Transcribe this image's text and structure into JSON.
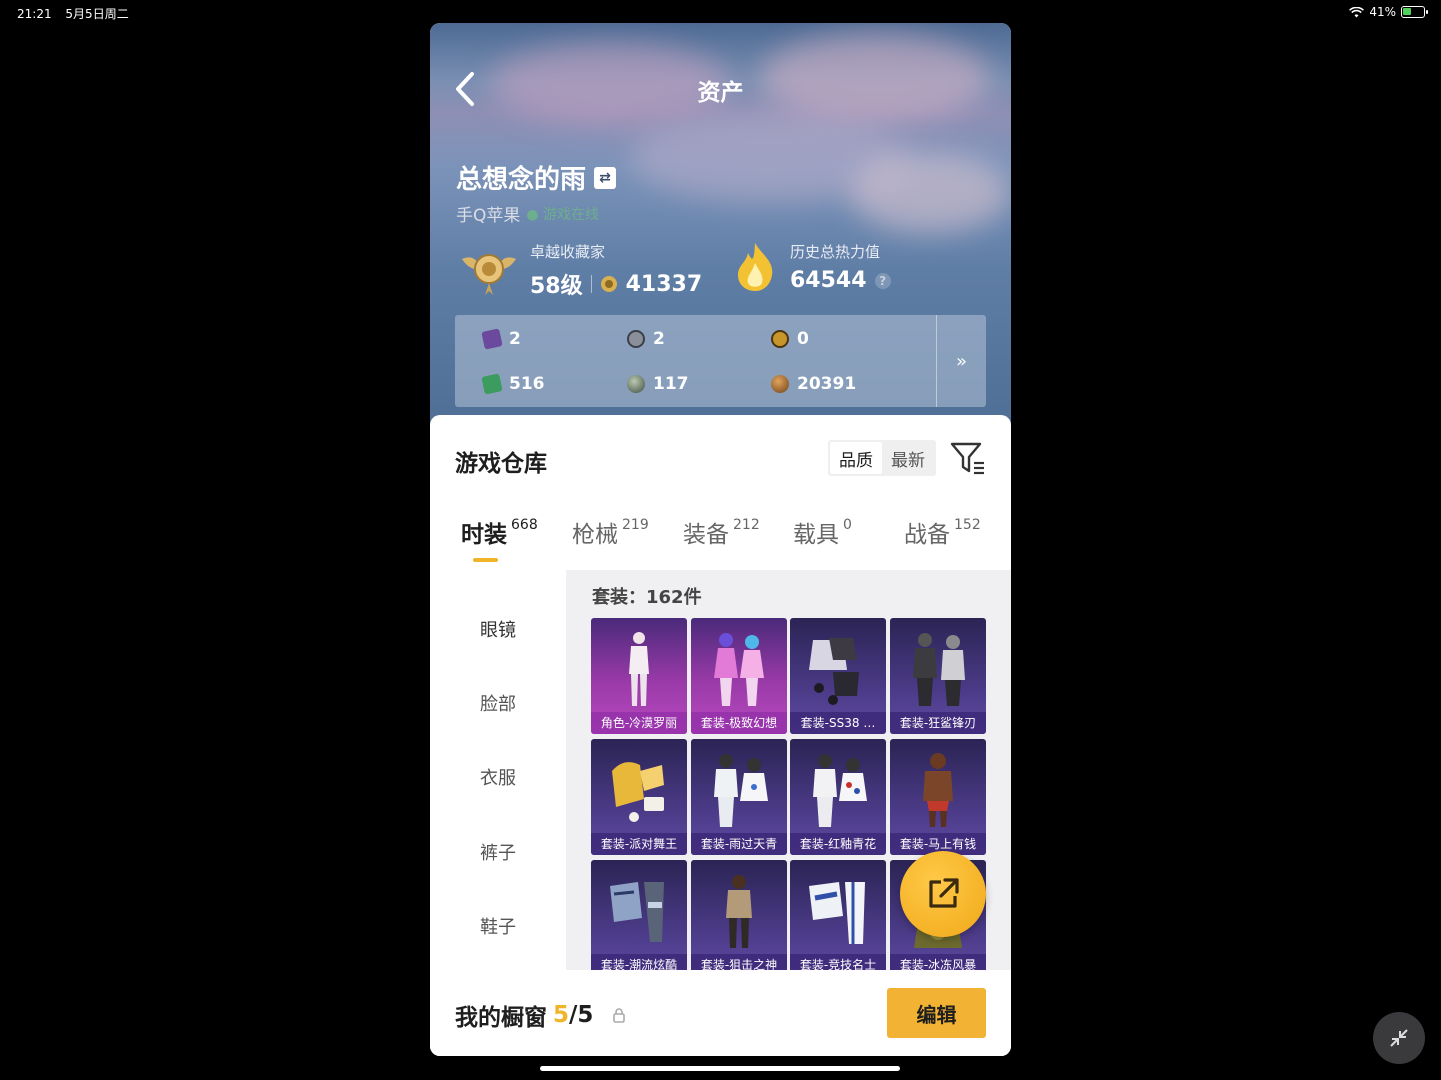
{
  "status_bar": {
    "time": "21:21",
    "date": "5月5日周二",
    "battery": "41%"
  },
  "header": {
    "title": "资产"
  },
  "profile": {
    "username": "总想念的雨",
    "platform": "手Q苹果",
    "online_status": "游戏在线"
  },
  "stats": {
    "collector_label": "卓越收藏家",
    "collector_level": "58级",
    "collector_points": "41337",
    "heat_label": "历史总热力值",
    "heat_value": "64544",
    "help_icon": "?"
  },
  "currencies": [
    {
      "icon": "purple-card-icon",
      "value": "2",
      "color": "#6b4a9e"
    },
    {
      "icon": "silver-coin-icon",
      "value": "2",
      "color": "#8a8f99"
    },
    {
      "icon": "gold-coin-icon",
      "value": "0",
      "color": "#c8952b"
    },
    {
      "icon": "green-card-icon",
      "value": "516",
      "color": "#3c9b5f"
    },
    {
      "icon": "gray-orb-icon",
      "value": "117",
      "color": "#6a7f6a"
    },
    {
      "icon": "bronze-coin-icon",
      "value": "20391",
      "color": "#b57a3c"
    }
  ],
  "warehouse": {
    "title": "游戏仓库",
    "sort_quality": "品质",
    "sort_newest": "最新",
    "tabs": [
      {
        "label": "时装",
        "count": "668"
      },
      {
        "label": "枪械",
        "count": "219"
      },
      {
        "label": "装备",
        "count": "212"
      },
      {
        "label": "载具",
        "count": "0"
      },
      {
        "label": "战备",
        "count": "152"
      }
    ],
    "subnav": [
      "眼镜",
      "脸部",
      "衣服",
      "裤子",
      "鞋子"
    ],
    "count_label": "套装：162件",
    "items": [
      {
        "name": "角色-冷漠罗丽",
        "style": "purple"
      },
      {
        "name": "套装-极致幻想",
        "style": "purple"
      },
      {
        "name": "套装-SS38 …",
        "style": "violet"
      },
      {
        "name": "套装-狂鲨锋刃",
        "style": "violet"
      },
      {
        "name": "套装-派对舞王",
        "style": "violet"
      },
      {
        "name": "套装-雨过天青",
        "style": "violet"
      },
      {
        "name": "套装-红釉青花",
        "style": "violet"
      },
      {
        "name": "套装-马上有钱",
        "style": "violet"
      },
      {
        "name": "套装-潮流炫酷",
        "style": "violet"
      },
      {
        "name": "套装-狙击之神",
        "style": "violet"
      },
      {
        "name": "套装-竞技名士",
        "style": "violet"
      },
      {
        "name": "套装-冰冻风暴",
        "style": "violet"
      }
    ]
  },
  "footer": {
    "showcase_label": "我的橱窗",
    "showcase_current": "5",
    "showcase_total": "/5",
    "edit_label": "编辑"
  },
  "colors": {
    "accent": "#f0b429",
    "card_purple": "#9a3aa8",
    "card_violet": "#4a3a86"
  }
}
